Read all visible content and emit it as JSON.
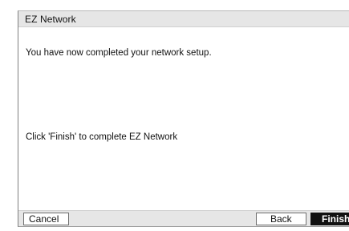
{
  "dialog": {
    "title": "EZ Network",
    "message_primary": "You have now completed your network setup.",
    "message_secondary": "Click 'Finish' to complete EZ Network",
    "buttons": {
      "cancel": "Cancel",
      "back": "Back",
      "finish": "Finish"
    }
  },
  "colors": {
    "title_bar_background": "#e6e6e6",
    "footer_background": "#e6e6e6",
    "primary_button_background": "#111111",
    "primary_button_text": "#ffffff"
  }
}
